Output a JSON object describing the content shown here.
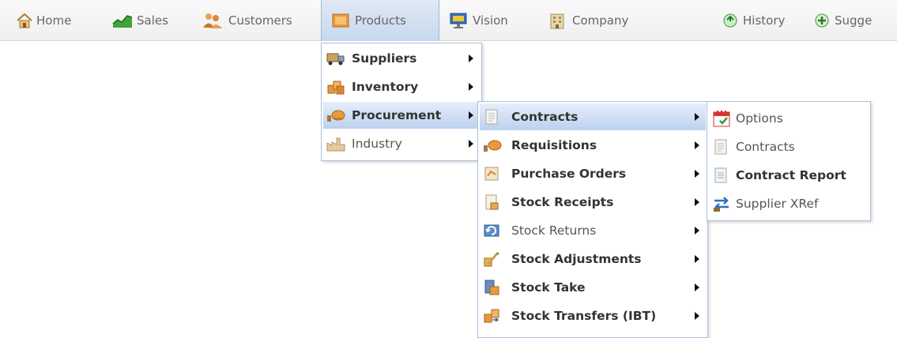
{
  "nav": {
    "home": "Home",
    "sales": "Sales",
    "customers": "Customers",
    "products": "Products",
    "vision": "Vision",
    "company": "Company",
    "history": "History",
    "suggest": "Sugge"
  },
  "products_menu": [
    "Suppliers",
    "Inventory",
    "Procurement",
    "Industry"
  ],
  "procurement_menu": [
    "Contracts",
    "Requisitions",
    "Purchase Orders",
    "Stock Receipts",
    "Stock Returns",
    "Stock Adjustments",
    "Stock Take",
    "Stock Transfers (IBT)"
  ],
  "contracts_menu": [
    "Options",
    "Contracts",
    "Contract Report",
    "Supplier XRef"
  ]
}
